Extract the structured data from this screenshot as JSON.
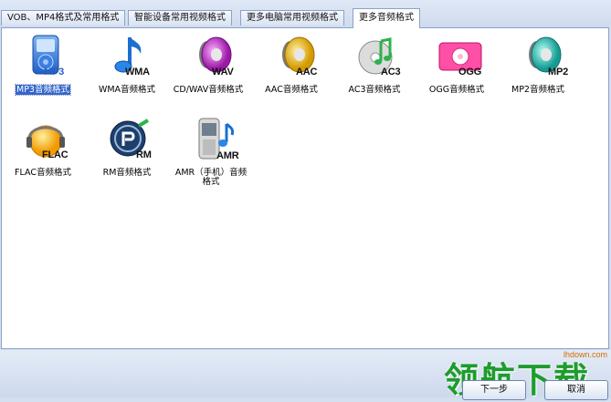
{
  "tabs": [
    {
      "label": "VOB、MP4格式及常用格式",
      "active": false
    },
    {
      "label": "智能设备常用视频格式",
      "active": false
    },
    {
      "label": "更多电脑常用视频格式",
      "active": false
    },
    {
      "label": "更多音频格式",
      "active": true
    }
  ],
  "formats": [
    {
      "badge": "MP3",
      "label": "MP3音频格式",
      "icon": "mp3-player-icon",
      "selected": true
    },
    {
      "badge": "WMA",
      "label": "WMA音频格式",
      "icon": "music-note-icon"
    },
    {
      "badge": "WAV",
      "label": "CD/WAV音频格式",
      "icon": "speaker-icon"
    },
    {
      "badge": "AAC",
      "label": "AAC音频格式",
      "icon": "speaker-icon"
    },
    {
      "badge": "AC3",
      "label": "AC3音频格式",
      "icon": "music-disc-icon"
    },
    {
      "badge": "OGG",
      "label": "OGG音频格式",
      "icon": "pink-player-icon"
    },
    {
      "badge": "MP2",
      "label": "MP2音频格式",
      "icon": "speaker-icon"
    },
    {
      "badge": "FLAC",
      "label": "FLAC音频格式",
      "icon": "headphone-orb-icon"
    },
    {
      "badge": "RM",
      "label": "RM音频格式",
      "icon": "realmedia-icon"
    },
    {
      "badge": "AMR",
      "label": "AMR（手机）音频格式",
      "icon": "mobile-phone-icon"
    }
  ],
  "buttons": {
    "next": "下一步",
    "cancel": "取消"
  },
  "watermark": {
    "text": "领航下载",
    "url": "lhdown.com"
  },
  "colors": {
    "selection": "#3366cc",
    "watermark": "#1e9c2d"
  }
}
